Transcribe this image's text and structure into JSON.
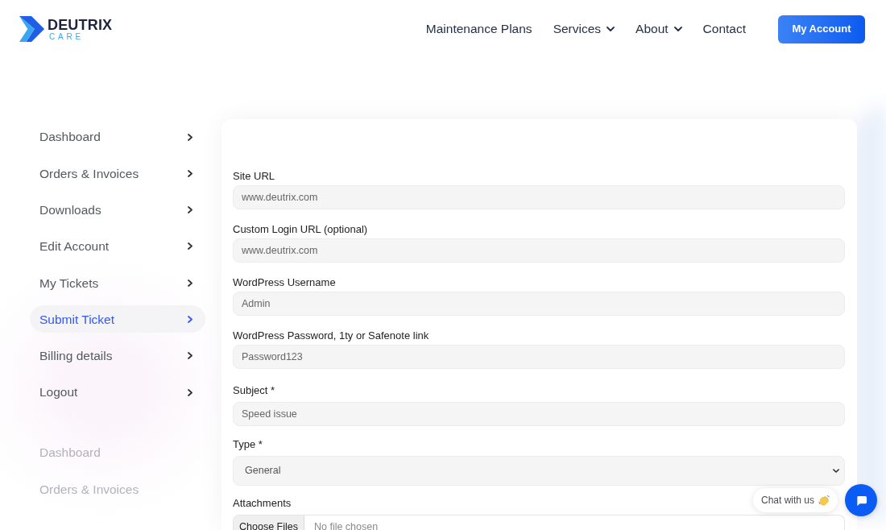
{
  "header": {
    "logo": {
      "name": "DEUTRIX",
      "tagline": "CARE"
    },
    "nav": [
      {
        "label": "Maintenance Plans",
        "has_menu": false
      },
      {
        "label": "Services",
        "has_menu": true
      },
      {
        "label": "About",
        "has_menu": true
      },
      {
        "label": "Contact",
        "has_menu": false
      }
    ],
    "account_button": "My Account"
  },
  "sidebar": {
    "items": [
      {
        "label": "Dashboard",
        "selected": false
      },
      {
        "label": "Orders & Invoices",
        "selected": false
      },
      {
        "label": "Downloads",
        "selected": false
      },
      {
        "label": "Edit Account",
        "selected": false
      },
      {
        "label": "My Tickets",
        "selected": false
      },
      {
        "label": "Submit Ticket",
        "selected": true
      },
      {
        "label": "Billing details",
        "selected": false
      },
      {
        "label": "Logout",
        "selected": false
      }
    ],
    "faded_items": [
      "Dashboard",
      "Orders & Invoices"
    ]
  },
  "form": {
    "sections": [
      {
        "fields": [
          {
            "kind": "text",
            "label": "Site URL",
            "placeholder": "www.deutrix.com"
          },
          {
            "kind": "text",
            "label": "Custom Login URL (optional)",
            "placeholder": "www.deutrix.com"
          },
          {
            "kind": "text",
            "label": "WordPress Username",
            "placeholder": "Admin"
          },
          {
            "kind": "text",
            "label": "WordPress Password, 1ty or Safenote link",
            "placeholder": "Password123"
          }
        ]
      },
      {
        "fields": [
          {
            "kind": "text",
            "label": "Subject *",
            "placeholder": "Speed issue"
          },
          {
            "kind": "select",
            "label": "Type *",
            "value": "General"
          },
          {
            "kind": "file",
            "label": "Attachments",
            "button": "Choose Files",
            "status": "No file chosen"
          }
        ]
      }
    ]
  },
  "chat": {
    "label": "Chat with us"
  }
}
